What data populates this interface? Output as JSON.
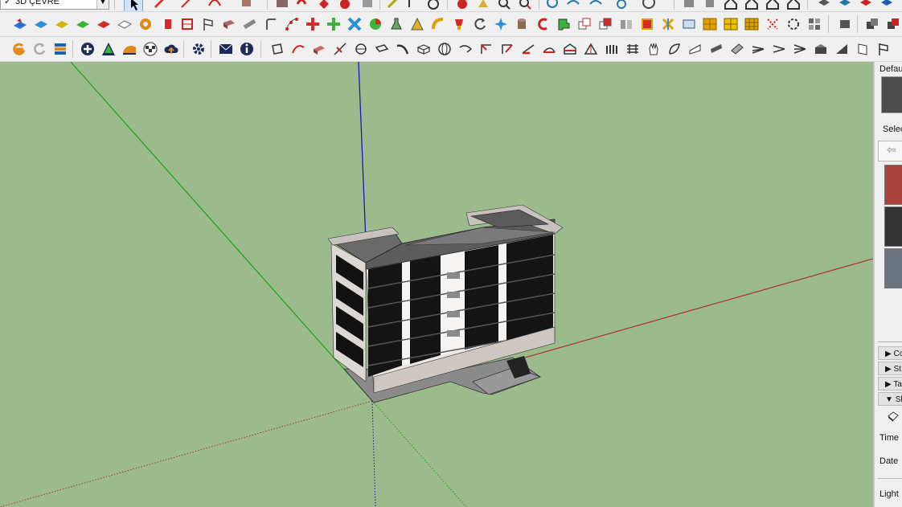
{
  "toolbar": {
    "layer_select": {
      "checkmark": "✓",
      "value": "3D ÇEVRE"
    },
    "row1_icons": [
      "select-arrow-icon",
      "pencil-icon",
      "line-icon",
      "arc-icon",
      "paint-bucket-icon",
      "book-icon",
      "hand-icon",
      "eraser-icon",
      "tape-icon",
      "zoom-icon",
      "zoom-extents-icon",
      "orbit-icon",
      "user-circle-icon",
      "cube-icon",
      "house-icon",
      "front-view-icon",
      "box-icon",
      "layers-icon"
    ],
    "row2_icons": [
      "blue-plane-icon",
      "blue-tile-icon",
      "yellow-plane-icon",
      "green-plane-icon",
      "red-plane-icon",
      "outline-plane-icon",
      "spiral-icon",
      "red-square-icon",
      "frame-icon",
      "flag-icon",
      "scroll-icon",
      "pipe-icon",
      "corner-icon",
      "dots-curve-icon",
      "red-cross-icon",
      "green-cross-icon",
      "blue-x-icon",
      "green-pie-icon",
      "flask-icon",
      "triangle-icon",
      "yellow-arc-icon",
      "trophy-icon",
      "rotate-icon",
      "star-icon",
      "cylinder-icon",
      "red-arc-icon",
      "puzzle-icon",
      "copy-icon",
      "array-icon",
      "box-array-icon",
      "red-gem-icon",
      "grid-icon",
      "frame-cut-icon",
      "orange-grid-icon",
      "yellow-grid-icon",
      "crosshair-icon",
      "circle-dots-icon",
      "component-icon",
      "small-box-icon",
      "stack-box-icon"
    ],
    "row3_icons": [
      "eneroth-icon",
      "refresh-icon",
      "stack-icon",
      "plus-circle-icon",
      "tree-icon",
      "ruler-icon",
      "checker-icon",
      "cloud-upload-icon",
      "gear-icon",
      "mail-icon",
      "info-icon",
      "edge-icon",
      "curve-icon",
      "extrude-icon",
      "knife-icon",
      "loop-icon",
      "fillet-icon",
      "bend-icon",
      "sphere-icon",
      "sweep-icon",
      "corner-trim-icon",
      "offset-icon",
      "slope-icon",
      "stair-icon",
      "roof-icon",
      "tent-icon",
      "fence-icon",
      "wall-icon",
      "hand-grab-icon",
      "leaf-icon",
      "shell-icon",
      "panel-icon",
      "line-array-icon",
      "split-icon",
      "flare-icon",
      "ramp-icon",
      "ramp-alt-icon",
      "door-icon"
    ]
  },
  "panel": {
    "default_label": "Defau",
    "select_label": "Selec",
    "sections": [
      "Co",
      "St",
      "Ta",
      "Sh"
    ],
    "expand_arrows": [
      "▶",
      "▶",
      "▶",
      "▼"
    ],
    "time_label": "Time",
    "date_label": "Date",
    "light_label": "Light"
  },
  "viewport": {
    "sky_ground_color": "#9bbb8d",
    "axis_colors": {
      "red": "#c0392b",
      "green": "#22aa22",
      "blue": "#2020c8"
    }
  }
}
